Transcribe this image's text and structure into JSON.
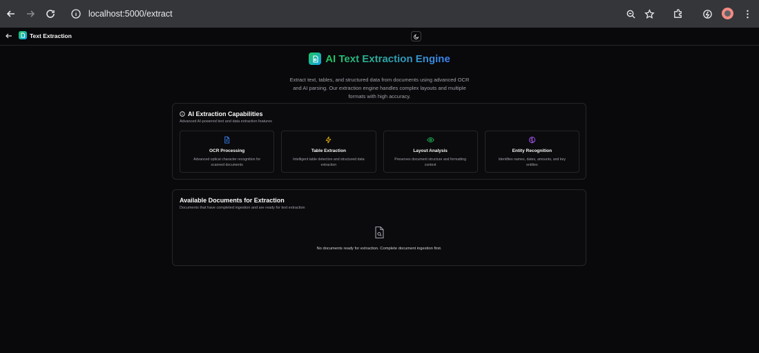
{
  "browser": {
    "url": "localhost:5000/extract"
  },
  "app": {
    "title": "Text Extraction"
  },
  "hero": {
    "title": "AI Text Extraction Engine",
    "description": "Extract text, tables, and structured data from documents using advanced OCR and AI parsing. Our extraction engine handles complex layouts and multiple formats with high accuracy."
  },
  "capabilities": {
    "title": "AI Extraction Capabilities",
    "subtitle": "Advanced AI-powered text and data extraction features",
    "items": [
      {
        "icon": "file-text-icon",
        "color": "#3b82f6",
        "name": "OCR Processing",
        "desc": "Advanced optical character recognition for scanned documents"
      },
      {
        "icon": "zap-icon",
        "color": "#eab308",
        "name": "Table Extraction",
        "desc": "Intelligent table detection and structured data extraction"
      },
      {
        "icon": "eye-icon",
        "color": "#22c55e",
        "name": "Layout Analysis",
        "desc": "Preserves document structure and formatting context"
      },
      {
        "icon": "brain-icon",
        "color": "#a855f7",
        "name": "Entity Recognition",
        "desc": "Identifies names, dates, amounts, and key entities"
      }
    ]
  },
  "documents": {
    "title": "Available Documents for Extraction",
    "subtitle": "Documents that have completed ingestion and are ready for text extraction",
    "empty_text": "No documents ready for extraction. Complete document ingestion first."
  }
}
